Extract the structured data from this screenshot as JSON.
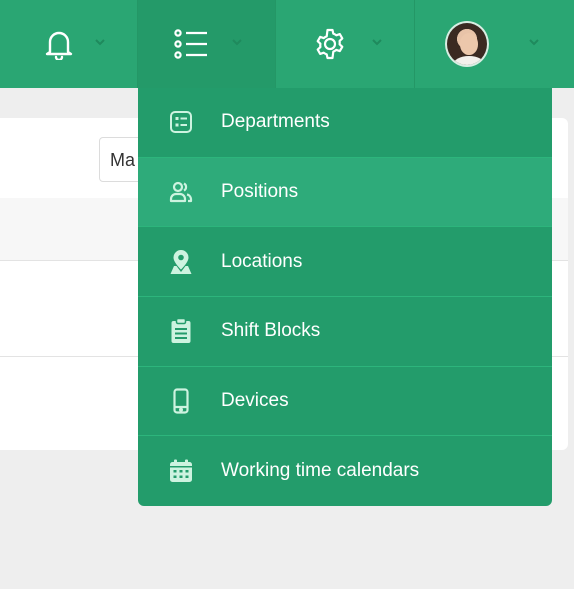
{
  "topbar": {
    "items": [
      {
        "name": "notifications",
        "icon": "bell-icon"
      },
      {
        "name": "menu",
        "icon": "list-icon",
        "active": true
      },
      {
        "name": "settings",
        "icon": "gear-icon"
      },
      {
        "name": "profile",
        "icon": "avatar"
      }
    ],
    "chevron_icon": "chevron-down-icon"
  },
  "background": {
    "select_value": "Ma"
  },
  "menu": {
    "items": [
      {
        "label": "Departments",
        "icon": "department-list-icon"
      },
      {
        "label": "Positions",
        "icon": "users-icon"
      },
      {
        "label": "Locations",
        "icon": "map-pin-icon"
      },
      {
        "label": "Shift Blocks",
        "icon": "clipboard-icon"
      },
      {
        "label": "Devices",
        "icon": "mobile-device-icon"
      },
      {
        "label": "Working time calendars",
        "icon": "calendar-icon"
      }
    ]
  },
  "colors": {
    "topbar": "#2aa673",
    "menu": "#239c6b",
    "menu_hover": "#2eab7a",
    "icon": "#cdf3e0"
  }
}
